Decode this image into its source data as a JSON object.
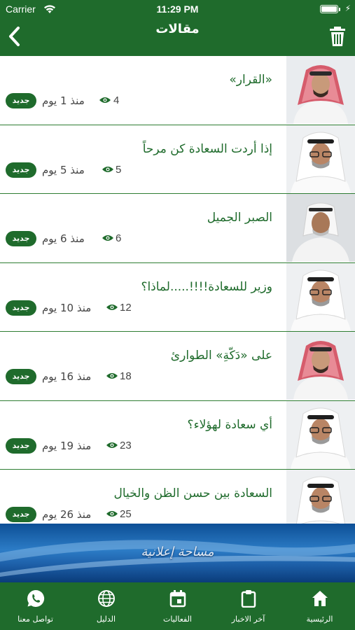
{
  "status_bar": {
    "carrier": "Carrier",
    "time": "11:29 PM"
  },
  "nav": {
    "title": "مقالات"
  },
  "articles": [
    {
      "title": "«القرار»",
      "views": "4",
      "ago": "منذ 1 يوم",
      "badge": "جديد"
    },
    {
      "title": "إذا أردت السعادة كن مرحاً",
      "views": "5",
      "ago": "منذ 5 يوم",
      "badge": "جديد"
    },
    {
      "title": "الصبر الجميل",
      "views": "6",
      "ago": "منذ 6 يوم",
      "badge": "جديد"
    },
    {
      "title": "وزير للسعادة!!!!.....لماذا؟",
      "views": "12",
      "ago": "منذ 10 يوم",
      "badge": "جديد"
    },
    {
      "title": "على «دَكّةِ» الطوارئ",
      "views": "18",
      "ago": "منذ 16 يوم",
      "badge": "جديد"
    },
    {
      "title": "أي سعادة لهؤلاء؟",
      "views": "23",
      "ago": "منذ 19 يوم",
      "badge": "جديد"
    },
    {
      "title": "السعادة بين حسن الظن والخيال",
      "views": "25",
      "ago": "منذ 26 يوم",
      "badge": "جديد"
    }
  ],
  "ad": {
    "text": "مساحة إعلانية"
  },
  "tabs": [
    {
      "label": "الرئيسية",
      "icon": "home-icon"
    },
    {
      "label": "آخر الاخبار",
      "icon": "clipboard-icon"
    },
    {
      "label": "الفعاليات",
      "icon": "calendar-icon"
    },
    {
      "label": "الدليل",
      "icon": "globe-icon"
    },
    {
      "label": "تواصل معنا",
      "icon": "whatsapp-icon"
    }
  ],
  "colors": {
    "brand_green": "#1f6b2c",
    "divider": "#2e7d32",
    "ad_blue": "#2c7cc6"
  }
}
